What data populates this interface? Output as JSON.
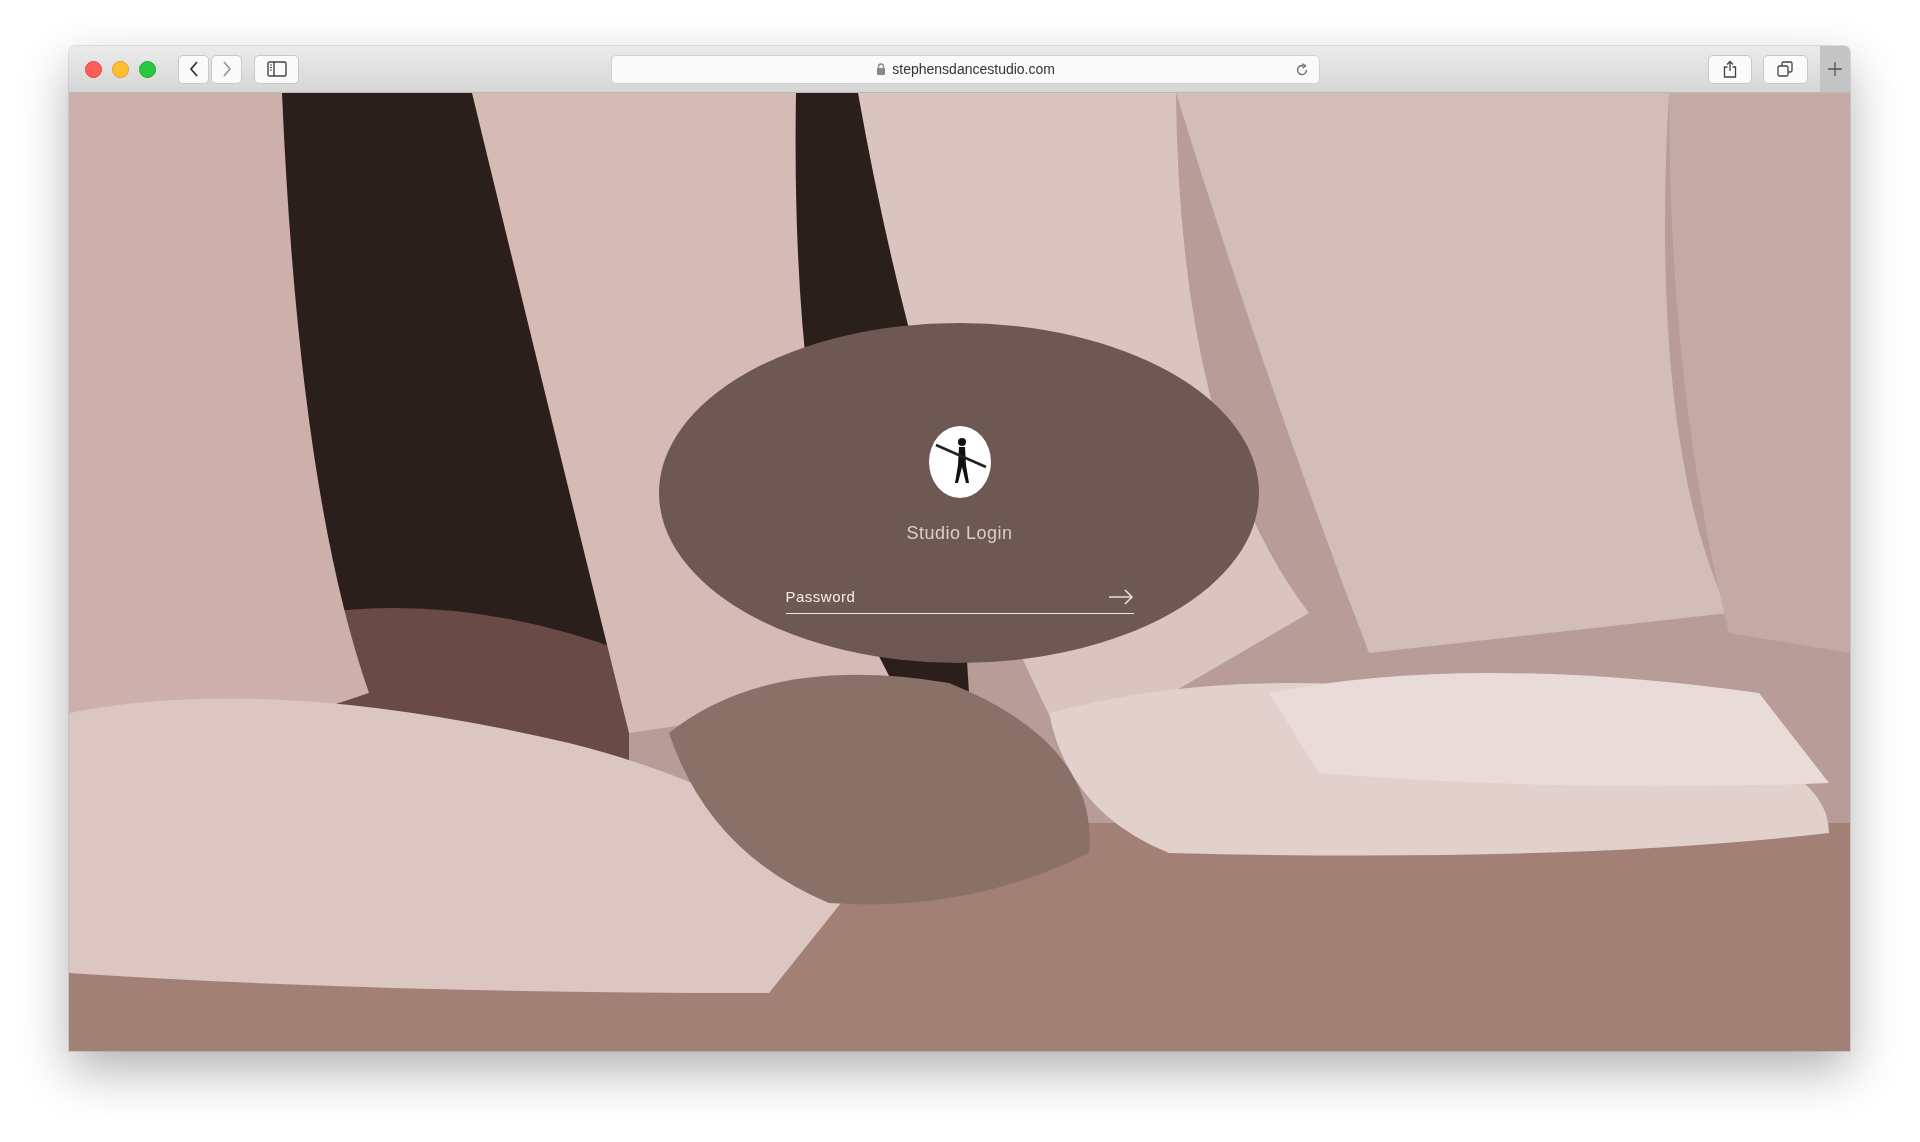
{
  "browser": {
    "url": "stephensdancestudio.com"
  },
  "page": {
    "title": "Studio Login",
    "password": {
      "placeholder": "Password"
    }
  }
}
